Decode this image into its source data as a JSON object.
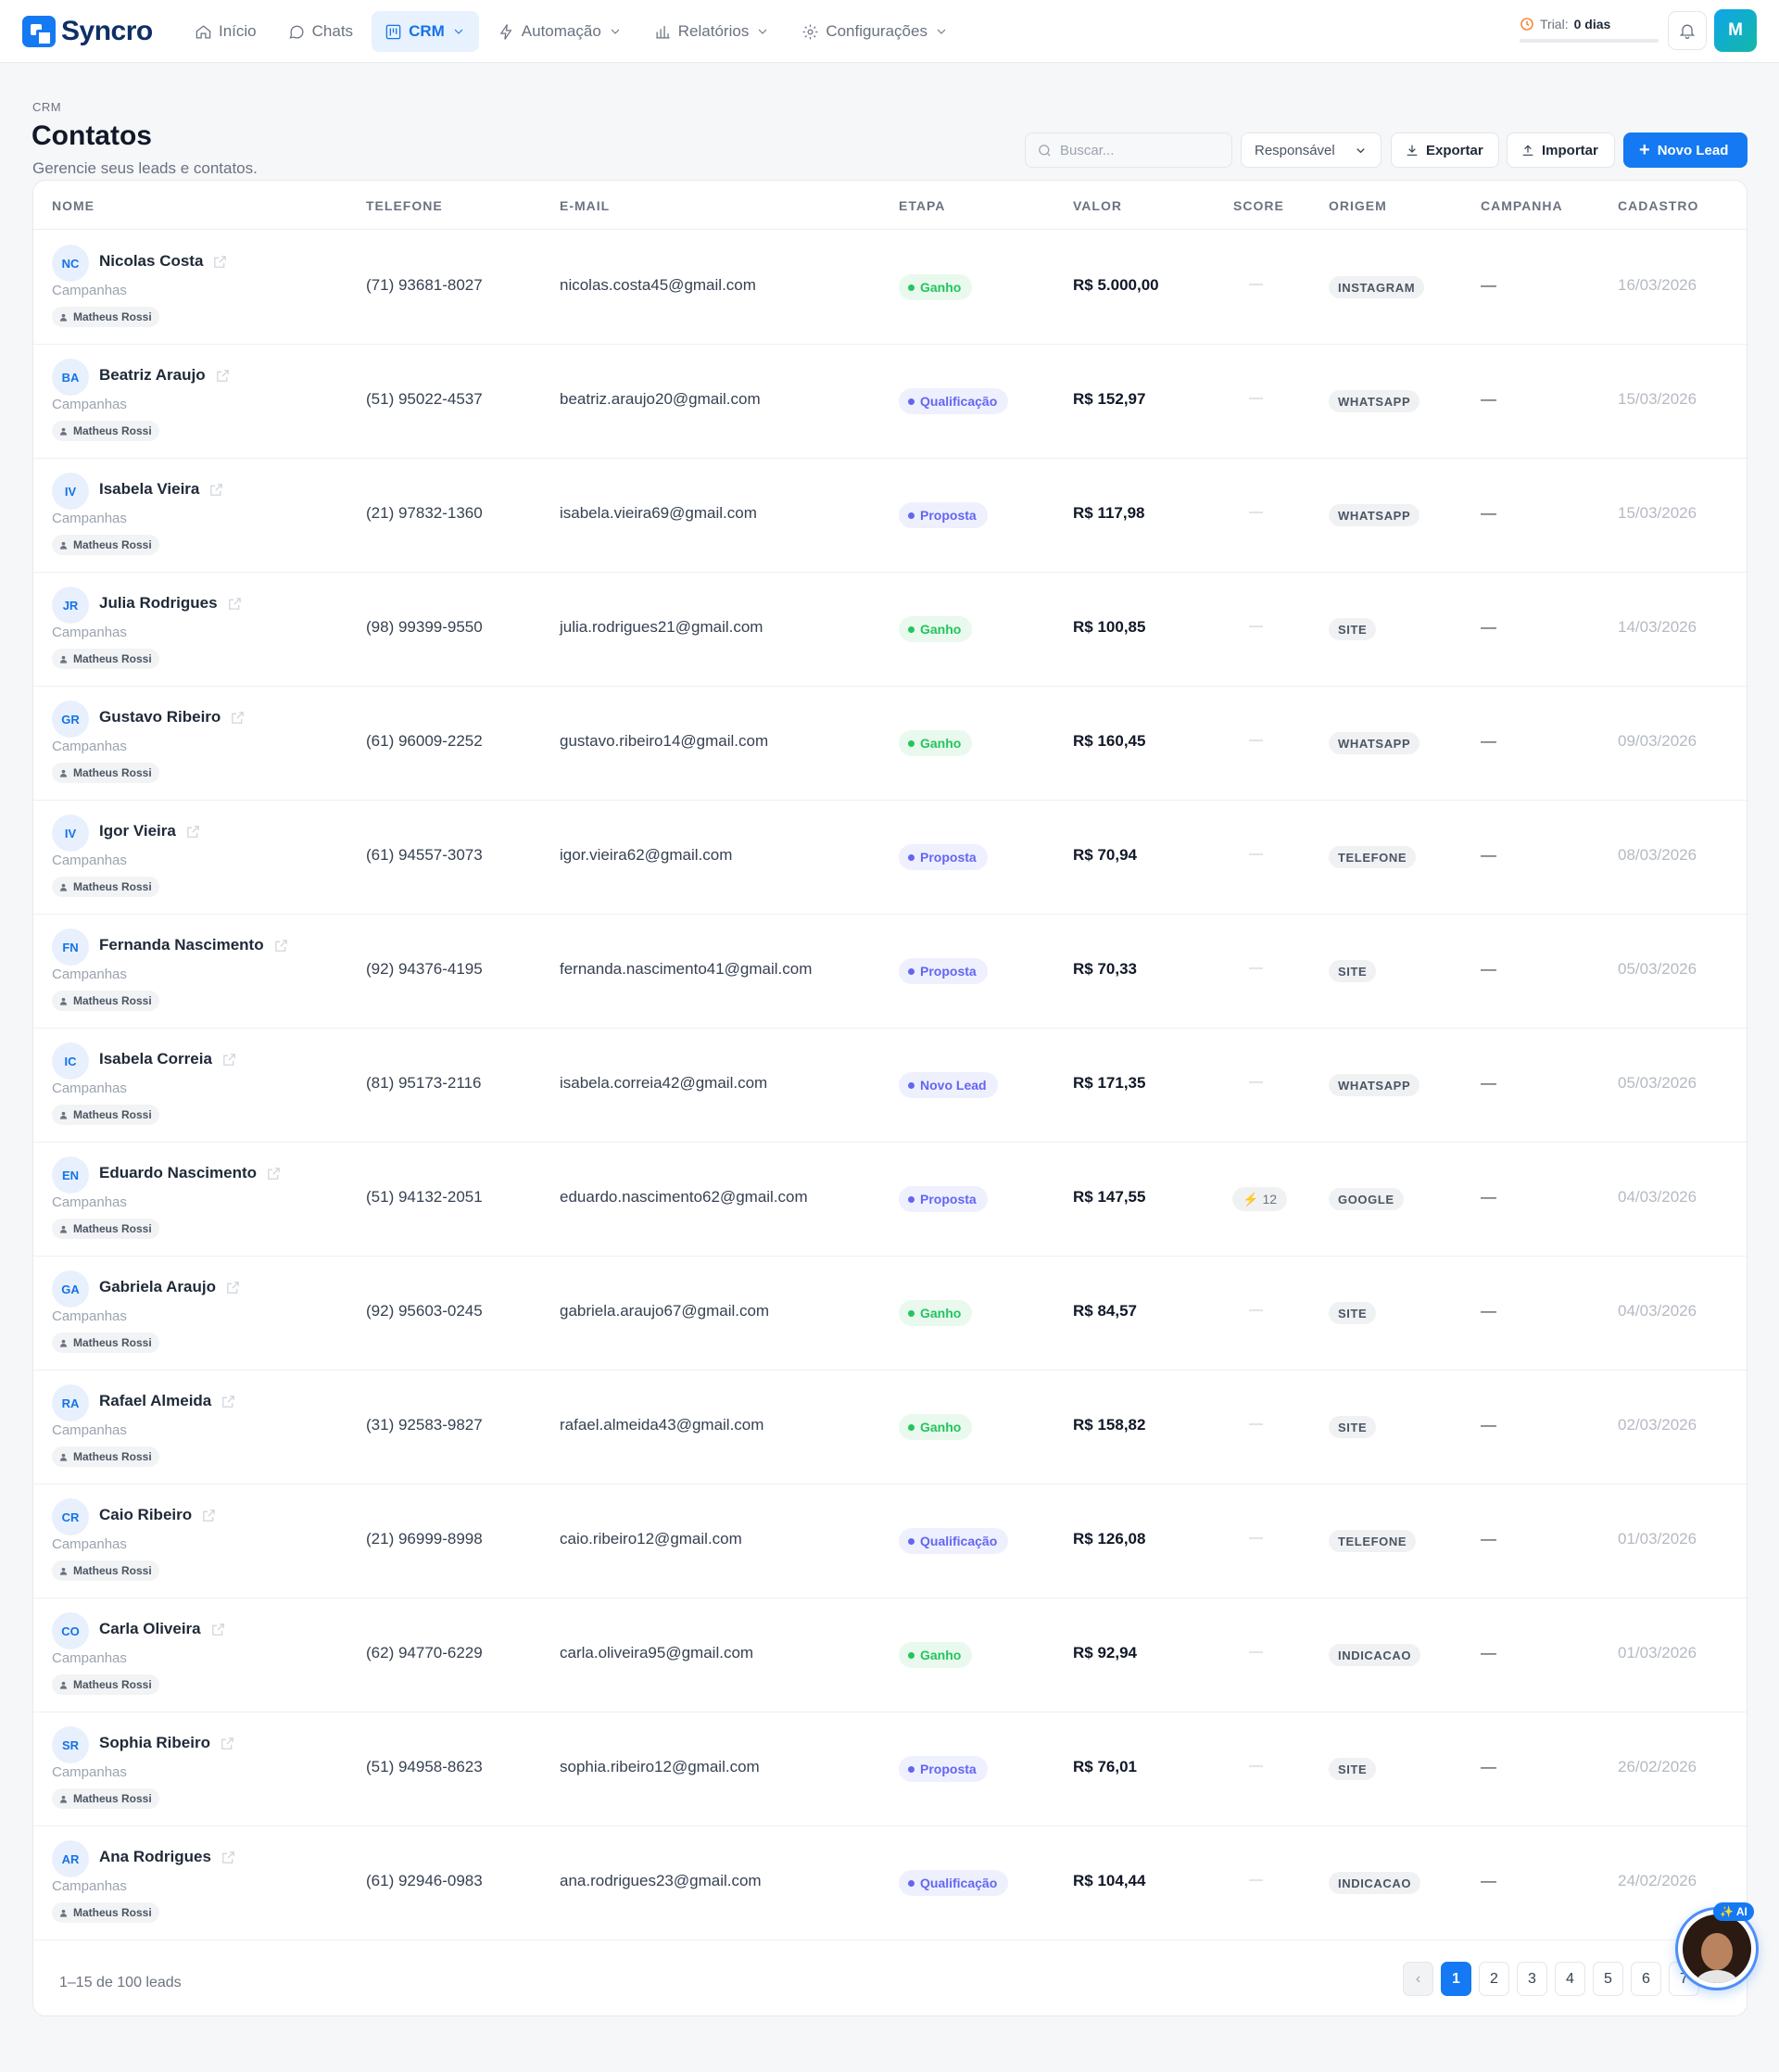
{
  "brand": {
    "name": "Syncro"
  },
  "nav": [
    {
      "label": "Início",
      "icon": "home-icon"
    },
    {
      "label": "Chats",
      "icon": "chat-icon"
    },
    {
      "label": "CRM",
      "icon": "crm-icon"
    },
    {
      "label": "Automação",
      "icon": "bolt-icon"
    },
    {
      "label": "Relatórios",
      "icon": "bar-chart-icon"
    },
    {
      "label": "Configurações",
      "icon": "gear-icon"
    }
  ],
  "trial": {
    "label": "Trial:",
    "value": "0 dias"
  },
  "user": {
    "initial": "M"
  },
  "page": {
    "breadcrumb": "CRM",
    "title": "Contatos",
    "subtitle": "Gerencie seus leads e contatos."
  },
  "toolbar": {
    "search_placeholder": "Buscar...",
    "responsavel": "Responsável",
    "export_label": "Exportar",
    "import_label": "Importar",
    "new_lead_label": "Novo Lead"
  },
  "table": {
    "headers": [
      "NOME",
      "TELEFONE",
      "E-MAIL",
      "ETAPA",
      "VALOR",
      "SCORE",
      "ORIGEM",
      "CAMPANHA",
      "CADASTRO"
    ],
    "rows": [
      {
        "initials": "NC",
        "name": "Nicolas Costa",
        "campanha_label": "Campanhas",
        "owner": "Matheus Rossi",
        "phone": "(71) 93681-8027",
        "email": "nicolas.costa45@gmail.com",
        "stage": "Ganho",
        "value": "R$ 5.000,00",
        "score": "—",
        "origin": "INSTAGRAM",
        "campaign": "—",
        "date": "16/03/2026"
      },
      {
        "initials": "BA",
        "name": "Beatriz Araujo",
        "campanha_label": "Campanhas",
        "owner": "Matheus Rossi",
        "phone": "(51) 95022-4537",
        "email": "beatriz.araujo20@gmail.com",
        "stage": "Qualificação",
        "value": "R$ 152,97",
        "score": "—",
        "origin": "WHATSAPP",
        "campaign": "—",
        "date": "15/03/2026"
      },
      {
        "initials": "IV",
        "name": "Isabela Vieira",
        "campanha_label": "Campanhas",
        "owner": "Matheus Rossi",
        "phone": "(21) 97832-1360",
        "email": "isabela.vieira69@gmail.com",
        "stage": "Proposta",
        "value": "R$ 117,98",
        "score": "—",
        "origin": "WHATSAPP",
        "campaign": "—",
        "date": "15/03/2026"
      },
      {
        "initials": "JR",
        "name": "Julia Rodrigues",
        "campanha_label": "Campanhas",
        "owner": "Matheus Rossi",
        "phone": "(98) 99399-9550",
        "email": "julia.rodrigues21@gmail.com",
        "stage": "Ganho",
        "value": "R$ 100,85",
        "score": "—",
        "origin": "SITE",
        "campaign": "—",
        "date": "14/03/2026"
      },
      {
        "initials": "GR",
        "name": "Gustavo Ribeiro",
        "campanha_label": "Campanhas",
        "owner": "Matheus Rossi",
        "phone": "(61) 96009-2252",
        "email": "gustavo.ribeiro14@gmail.com",
        "stage": "Ganho",
        "value": "R$ 160,45",
        "score": "—",
        "origin": "WHATSAPP",
        "campaign": "—",
        "date": "09/03/2026"
      },
      {
        "initials": "IV",
        "name": "Igor Vieira",
        "campanha_label": "Campanhas",
        "owner": "Matheus Rossi",
        "phone": "(61) 94557-3073",
        "email": "igor.vieira62@gmail.com",
        "stage": "Proposta",
        "value": "R$ 70,94",
        "score": "—",
        "origin": "TELEFONE",
        "campaign": "—",
        "date": "08/03/2026"
      },
      {
        "initials": "FN",
        "name": "Fernanda Nascimento",
        "campanha_label": "Campanhas",
        "owner": "Matheus Rossi",
        "phone": "(92) 94376-4195",
        "email": "fernanda.nascimento41@gmail.com",
        "stage": "Proposta",
        "value": "R$ 70,33",
        "score": "—",
        "origin": "SITE",
        "campaign": "—",
        "date": "05/03/2026"
      },
      {
        "initials": "IC",
        "name": "Isabela Correia",
        "campanha_label": "Campanhas",
        "owner": "Matheus Rossi",
        "phone": "(81) 95173-2116",
        "email": "isabela.correia42@gmail.com",
        "stage": "Novo Lead",
        "value": "R$ 171,35",
        "score": "—",
        "origin": "WHATSAPP",
        "campaign": "—",
        "date": "05/03/2026"
      },
      {
        "initials": "EN",
        "name": "Eduardo Nascimento",
        "campanha_label": "Campanhas",
        "owner": "Matheus Rossi",
        "phone": "(51) 94132-2051",
        "email": "eduardo.nascimento62@gmail.com",
        "stage": "Proposta",
        "value": "R$ 147,55",
        "score": "12",
        "origin": "GOOGLE",
        "campaign": "—",
        "date": "04/03/2026"
      },
      {
        "initials": "GA",
        "name": "Gabriela Araujo",
        "campanha_label": "Campanhas",
        "owner": "Matheus Rossi",
        "phone": "(92) 95603-0245",
        "email": "gabriela.araujo67@gmail.com",
        "stage": "Ganho",
        "value": "R$ 84,57",
        "score": "—",
        "origin": "SITE",
        "campaign": "—",
        "date": "04/03/2026"
      },
      {
        "initials": "RA",
        "name": "Rafael Almeida",
        "campanha_label": "Campanhas",
        "owner": "Matheus Rossi",
        "phone": "(31) 92583-9827",
        "email": "rafael.almeida43@gmail.com",
        "stage": "Ganho",
        "value": "R$ 158,82",
        "score": "—",
        "origin": "SITE",
        "campaign": "—",
        "date": "02/03/2026"
      },
      {
        "initials": "CR",
        "name": "Caio Ribeiro",
        "campanha_label": "Campanhas",
        "owner": "Matheus Rossi",
        "phone": "(21) 96999-8998",
        "email": "caio.ribeiro12@gmail.com",
        "stage": "Qualificação",
        "value": "R$ 126,08",
        "score": "—",
        "origin": "TELEFONE",
        "campaign": "—",
        "date": "01/03/2026"
      },
      {
        "initials": "CO",
        "name": "Carla Oliveira",
        "campanha_label": "Campanhas",
        "owner": "Matheus Rossi",
        "phone": "(62) 94770-6229",
        "email": "carla.oliveira95@gmail.com",
        "stage": "Ganho",
        "value": "R$ 92,94",
        "score": "—",
        "origin": "INDICACAO",
        "campaign": "—",
        "date": "01/03/2026"
      },
      {
        "initials": "SR",
        "name": "Sophia Ribeiro",
        "campanha_label": "Campanhas",
        "owner": "Matheus Rossi",
        "phone": "(51) 94958-8623",
        "email": "sophia.ribeiro12@gmail.com",
        "stage": "Proposta",
        "value": "R$ 76,01",
        "score": "—",
        "origin": "SITE",
        "campaign": "—",
        "date": "26/02/2026"
      },
      {
        "initials": "AR",
        "name": "Ana Rodrigues",
        "campanha_label": "Campanhas",
        "owner": "Matheus Rossi",
        "phone": "(61) 92946-0983",
        "email": "ana.rodrigues23@gmail.com",
        "stage": "Qualificação",
        "value": "R$ 104,44",
        "score": "—",
        "origin": "INDICACAO",
        "campaign": "—",
        "date": "24/02/2026"
      }
    ]
  },
  "stage_colors": {
    "Ganho": {
      "bg": "#e9f9ee",
      "fg": "#22c55e"
    },
    "Qualificação": {
      "bg": "#eef0fe",
      "fg": "#6366f1"
    },
    "Proposta": {
      "bg": "#eef0fe",
      "fg": "#6366f1"
    },
    "Novo Lead": {
      "bg": "#eef0fe",
      "fg": "#6366f1"
    }
  },
  "footer": {
    "range": "1–15 de 100 leads",
    "pages": [
      "‹",
      "1",
      "2",
      "3",
      "4",
      "5",
      "6",
      "7"
    ],
    "active_page": "1"
  },
  "ai_widget": {
    "badge": "✨ AI"
  }
}
